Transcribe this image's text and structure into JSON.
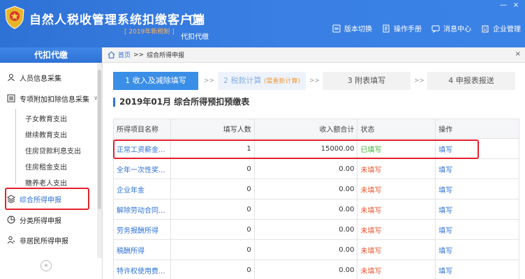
{
  "app": {
    "title": "自然人税收管理系统扣缴客户端",
    "version_badge": "[ 2019年新税制 ]",
    "proxy_label": "代扣代缴",
    "window_controls": [
      "—",
      "×"
    ]
  },
  "top_menu": [
    {
      "label": "版本切换",
      "icon": "version-switch-icon"
    },
    {
      "label": "操作手册",
      "icon": "manual-icon"
    },
    {
      "label": "消息中心",
      "icon": "message-icon"
    },
    {
      "label": "企业管理",
      "icon": "enterprise-icon"
    }
  ],
  "sidebar": {
    "header": "代扣代缴",
    "items": [
      {
        "label": "人员信息采集",
        "icon": "user-icon"
      },
      {
        "label": "专项附加扣除信息采集",
        "icon": "list-icon"
      },
      {
        "label": "综合所得申报",
        "icon": "layers-icon"
      },
      {
        "label": "分类所得申报",
        "icon": "pie-icon"
      },
      {
        "label": "非居民所得申报",
        "icon": "person-icon"
      }
    ],
    "sub_items": [
      "子女教育支出",
      "继续教育支出",
      "住房贷款利息支出",
      "住房租金支出",
      "赡养老人支出"
    ],
    "collapse": "«"
  },
  "breadcrumb": {
    "home": "首页",
    "separator": ">>",
    "current": "综合所得申报",
    "close": "×"
  },
  "steps": [
    {
      "label": "1 收入及减除填写"
    },
    {
      "label": "2 税款计算",
      "sub": "(需重新计算)"
    },
    {
      "label": "3 附表填写"
    },
    {
      "label": "4 申报表报送"
    }
  ],
  "step_arrow": ">>",
  "form_title": "2019年01月  综合所得预扣预缴表",
  "table": {
    "headers": [
      "所得项目名称",
      "填写人数",
      "收入额合计",
      "状态",
      "操作"
    ],
    "rows": [
      {
        "name": "正常工资薪金...",
        "count": "1",
        "income": "15000.00",
        "status": "已填写",
        "status_type": "done",
        "action": "填写"
      },
      {
        "name": "全年一次性奖...",
        "count": "0",
        "income": "0.00",
        "status": "未填写",
        "status_type": "todo",
        "action": "填写"
      },
      {
        "name": "企业年金",
        "count": "0",
        "income": "0.00",
        "status": "未填写",
        "status_type": "todo",
        "action": "填写"
      },
      {
        "name": "解除劳动合同...",
        "count": "0",
        "income": "0.00",
        "status": "未填写",
        "status_type": "todo",
        "action": "填写"
      },
      {
        "name": "劳务报酬所得",
        "count": "0",
        "income": "0.00",
        "status": "未填写",
        "status_type": "todo",
        "action": "填写"
      },
      {
        "name": "稿酬所得",
        "count": "0",
        "income": "0.00",
        "status": "未填写",
        "status_type": "todo",
        "action": "填写"
      },
      {
        "name": "特许权使用费...",
        "count": "0",
        "income": "0.00",
        "status": "未填写",
        "status_type": "todo",
        "action": "填写"
      }
    ]
  }
}
